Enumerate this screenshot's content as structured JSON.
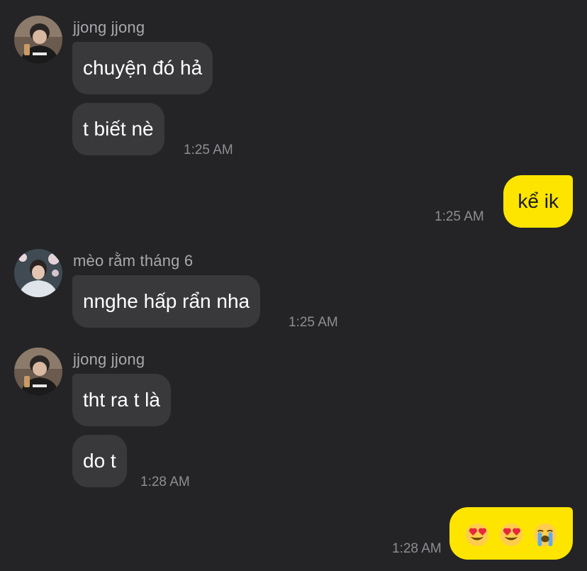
{
  "messages": {
    "m1": {
      "sender": "jjong jjong",
      "bubbles": [
        "chuyện đó hả",
        "t biết nè"
      ],
      "time": "1:25 AM"
    },
    "m2": {
      "text": "kể ik",
      "time": "1:25 AM"
    },
    "m3": {
      "sender": "mèo rằm tháng 6",
      "bubbles": [
        "nnghe hấp rẩn nha"
      ],
      "time": "1:25 AM"
    },
    "m4": {
      "sender": "jjong jjong",
      "bubbles": [
        "tht ra t là",
        "do t"
      ],
      "time": "1:28 AM"
    },
    "m5": {
      "emojis": [
        "heart-eyes-emoji",
        "heart-eyes-emoji",
        "loudly-crying-emoji"
      ],
      "time": "1:28 AM"
    }
  },
  "colors": {
    "background": "#242426",
    "incoming_bubble": "#39393c",
    "outgoing_bubble": "#fde500",
    "sender_text": "#a9a9ad",
    "timestamp": "#8e8e93"
  }
}
